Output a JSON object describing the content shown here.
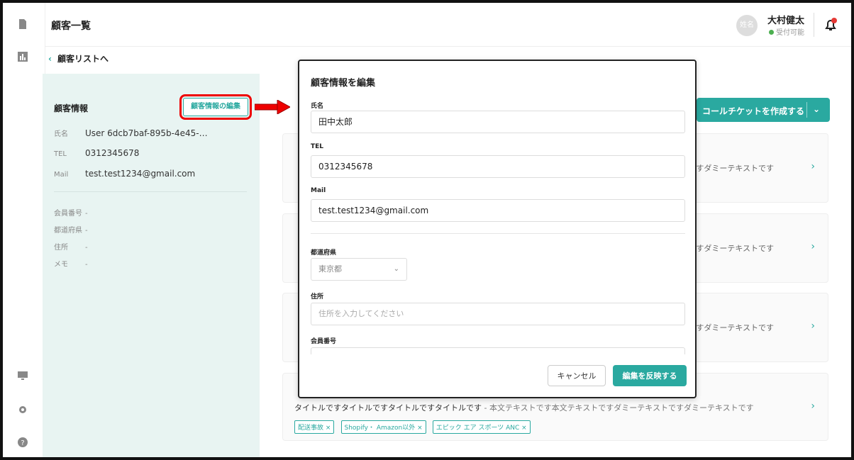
{
  "header": {
    "title": "顧客一覧",
    "user_avatar": "姓名",
    "user_name": "大村健太",
    "user_status": "受付可能"
  },
  "back_link": "顧客リストへ",
  "customer": {
    "section_title": "顧客情報",
    "edit_button": "顧客情報の編集",
    "fields": [
      {
        "key": "氏名",
        "value": "User 6dcb7baf-895b-4e45-…"
      },
      {
        "key": "TEL",
        "value": "0312345678"
      },
      {
        "key": "Mail",
        "value": "test.test1234@gmail.com"
      }
    ],
    "extra": [
      {
        "key": "会員番号",
        "value": "-"
      },
      {
        "key": "都道府県",
        "value": "-"
      },
      {
        "key": "住所",
        "value": "-"
      },
      {
        "key": "メモ",
        "value": "-"
      }
    ]
  },
  "cta": {
    "label": "コールチケットを作成する"
  },
  "cards": [
    {
      "snippet": "すダミーテキストです"
    },
    {
      "snippet": "すダミーテキストです"
    },
    {
      "snippet": "すダミーテキストです"
    }
  ],
  "last_card": {
    "title": "タイトルですタイトルですタイトルですタイトルです",
    "body": " - 本文テキストです本文テキストですダミーテキストですダミーテキストです",
    "tags": [
      "配送事故 ×",
      "Shopify・ Amazon以外 ×",
      "エピック エア スポーツ ANC ×"
    ]
  },
  "modal": {
    "title": "顧客情報を編集",
    "name_label": "氏名",
    "name_value": "田中太郎",
    "tel_label": "TEL",
    "tel_value": "0312345678",
    "mail_label": "Mail",
    "mail_value": "test.test1234@gmail.com",
    "pref_label": "都道府県",
    "pref_value": "東京都",
    "address_label": "住所",
    "address_placeholder": "住所を入力してください",
    "member_label": "会員番号",
    "cancel_button": "キャンセル",
    "apply_button": "編集を反映する"
  },
  "colors": {
    "accent": "#2aa9a0",
    "panel_bg": "#e8f4f2",
    "highlight": "#e00000"
  }
}
